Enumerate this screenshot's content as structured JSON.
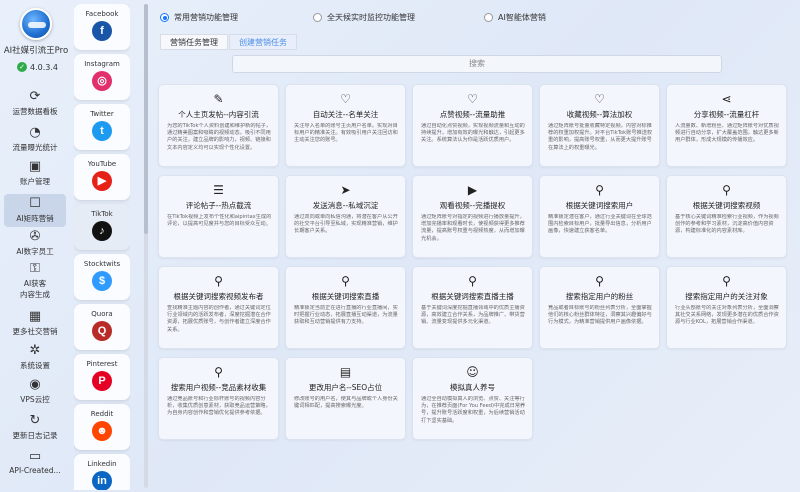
{
  "app": {
    "name": "AI社媒引流王Pro",
    "version": "4.0.3.4"
  },
  "nav": [
    {
      "label": "运营数据看板",
      "icon": "⟳"
    },
    {
      "label": "流量曝光统计",
      "icon": "◔"
    },
    {
      "label": "账户管理",
      "icon": "▣"
    },
    {
      "label": "AI矩阵营销",
      "icon": "☐"
    },
    {
      "label": "AI数字员工",
      "icon": "✇"
    },
    {
      "label": "AI获客",
      "label2": "内容生成",
      "icon": "⚿"
    },
    {
      "label": "更多社交营销",
      "icon": "▦"
    },
    {
      "label": "系统设置",
      "icon": "✲"
    },
    {
      "label": "VPS云控",
      "icon": "◉"
    },
    {
      "label": "更新日志记录",
      "icon": "↻"
    },
    {
      "label": "API-Created...",
      "icon": "▭"
    }
  ],
  "platforms": [
    {
      "label": "Facebook",
      "glyph": "f",
      "color": "#1a56a8"
    },
    {
      "label": "Instagram",
      "glyph": "◎",
      "color": "#e1306c"
    },
    {
      "label": "Twitter",
      "glyph": "t",
      "color": "#1d9bf0"
    },
    {
      "label": "YouTube",
      "glyph": "▶",
      "color": "#e62117"
    },
    {
      "label": "TikTok",
      "glyph": "♪",
      "color": "#111111"
    },
    {
      "label": "Stocktwits",
      "glyph": "$",
      "color": "#2f9bff"
    },
    {
      "label": "Quora",
      "glyph": "Q",
      "color": "#b92b27"
    },
    {
      "label": "Pinterest",
      "glyph": "P",
      "color": "#e60023"
    },
    {
      "label": "Reddit",
      "glyph": "☻",
      "color": "#ff4500"
    },
    {
      "label": "Linkedin",
      "glyph": "in",
      "color": "#0a66c2"
    }
  ],
  "radios": [
    {
      "label": "常用营销功能管理"
    },
    {
      "label": "全天候实时监控功能管理"
    },
    {
      "label": "AI智能体营销"
    }
  ],
  "tabs": [
    {
      "label": "营销任务管理"
    },
    {
      "label": "创建营销任务"
    }
  ],
  "search": {
    "placeholder": "搜索"
  },
  "cards": [
    {
      "title": "个人主页发帖--内容引流",
      "icon": "✎",
      "desc": "为您的TikTok个人资料创建和维护新的帖子，通过精美图案和吸睛的视频动态，吸引不同用户的关注，建立品牌的影响力，视频、链接和文本内容定义均可以实现个性化设置。"
    },
    {
      "title": "自动关注--名单关注",
      "icon": "♡",
      "desc": "关注导入名单的账号主页用户名单。实现对目标用户的精准关注。有效吸引用户关注回访和主动关注您的账号。"
    },
    {
      "title": "点赞视频--流量助推",
      "icon": "♡",
      "desc": "通过自动化点赞视频，实现视频流量和互动的持续提升，增加有效的曝光和触达，引起更多关注。系统算法认为你是活跃优质用户。"
    },
    {
      "title": "收藏视频--算法加权",
      "icon": "♡",
      "desc": "通过矩阵账号批量收藏特定视频，内容对标推荐的权重加权提升。对平台TikTok账号推送权重的影响，提高账号权重，从而更大提升账号在算法上的权重曝光。"
    },
    {
      "title": "分享视频--流量杠杆",
      "icon": "⋖",
      "desc": "人流量数、新增粉丝、通过矩阵账号对优质视频进行自动分享，扩大覆盖范围，触达更多新用户群体，形成大规模的传播效应。"
    },
    {
      "title": "评论帖子--热点截流",
      "icon": "☰",
      "desc": "在TikTok视频上发布个性化和aipintax生成的评论，以提高可见度并与您的目标受众互动。"
    },
    {
      "title": "发送消息--私域沉淀",
      "icon": "➤",
      "desc": "通过双向或单向私信沟通，将潜在客户从公开的社交平台引导至私域，实现精准营销，维护长期客户关系。"
    },
    {
      "title": "观看视频--完播提权",
      "icon": "▶",
      "desc": "通过矩阵账号对指定的视频进行播放量提升，增加完播率和观看时长，使视频获得更多推荐流量，提高账号权重与视频热度，从而增加曝光机会。"
    },
    {
      "title": "根据关键词搜索用户",
      "icon": "⚲",
      "desc": "精准锁定潜在客户，通过行业关键词在全球范围内检索目标用户，批量导出信息，分析用户画像，快速建立获客名单。"
    },
    {
      "title": "根据关键词搜索视频",
      "icon": "⚲",
      "desc": "基于核心关键词精准检索行业视频，作为视频创作的参考和学习素材，沉淀高价值内容资源，构建标准化的内容素材库。"
    },
    {
      "title": "根据关键词搜索视频发布者",
      "icon": "⚲",
      "desc": "查找精准主题内容的创作者，通过关键词定位行业领域内的活跃发布者，深度挖掘潜在合作资源，拓展优质账号，与创作者建立深度合作关系。"
    },
    {
      "title": "根据关键词搜索直播",
      "icon": "⚲",
      "desc": "精准锁定当前正在进行直播的行业直播间，实时把握行业动态，拓展直播互动渠道，为流量获取和互动营销提供有力支持。"
    },
    {
      "title": "根据关键词搜索直播主播",
      "icon": "⚲",
      "desc": "基于关键词深度挖掘直播领域中的优质主播资源，高效建立合作关系，为品牌推广、带货营销、流量变现提供多元化渠道。"
    },
    {
      "title": "搜索指定用户的粉丝",
      "icon": "⚲",
      "desc": "竞品或者目标账号的粉丝列表分析，全面掌握他们的核心粉丝群体特征，洞察其兴趣偏好与行为模式，为精准营销提供用户画像依据。"
    },
    {
      "title": "搜索指定用户的关注对象",
      "icon": "⚲",
      "desc": "行业头部账号的关注对象列表分析，全面洞察其社交关系网络，发现更多潜在的优质合作资源与行业KOL，拓展营销合作渠道。"
    },
    {
      "title": "搜索用户视频--竞品素材收集",
      "icon": "⚲",
      "desc": "通过竞品账号和行业标杆账号的视频内容分析，收集优质创意素材，获取竞品运营策略，为自身内容创作和营销优化提供参考依据。"
    },
    {
      "title": "更改用户名--SEO占位",
      "icon": "▤",
      "desc": "修改账号的用户名，使其与品牌或个人身份关键词相匹配，提高搜索曝光度。"
    },
    {
      "title": "模拟真人养号",
      "icon": "☺",
      "desc": "通过全自动模拟真人的浏览、点赞、关注等行为，在推荐页面(For You Feed)中完成日常养号，提升账号活跃度和权重，为后续营销活动打下坚实基础。"
    }
  ]
}
